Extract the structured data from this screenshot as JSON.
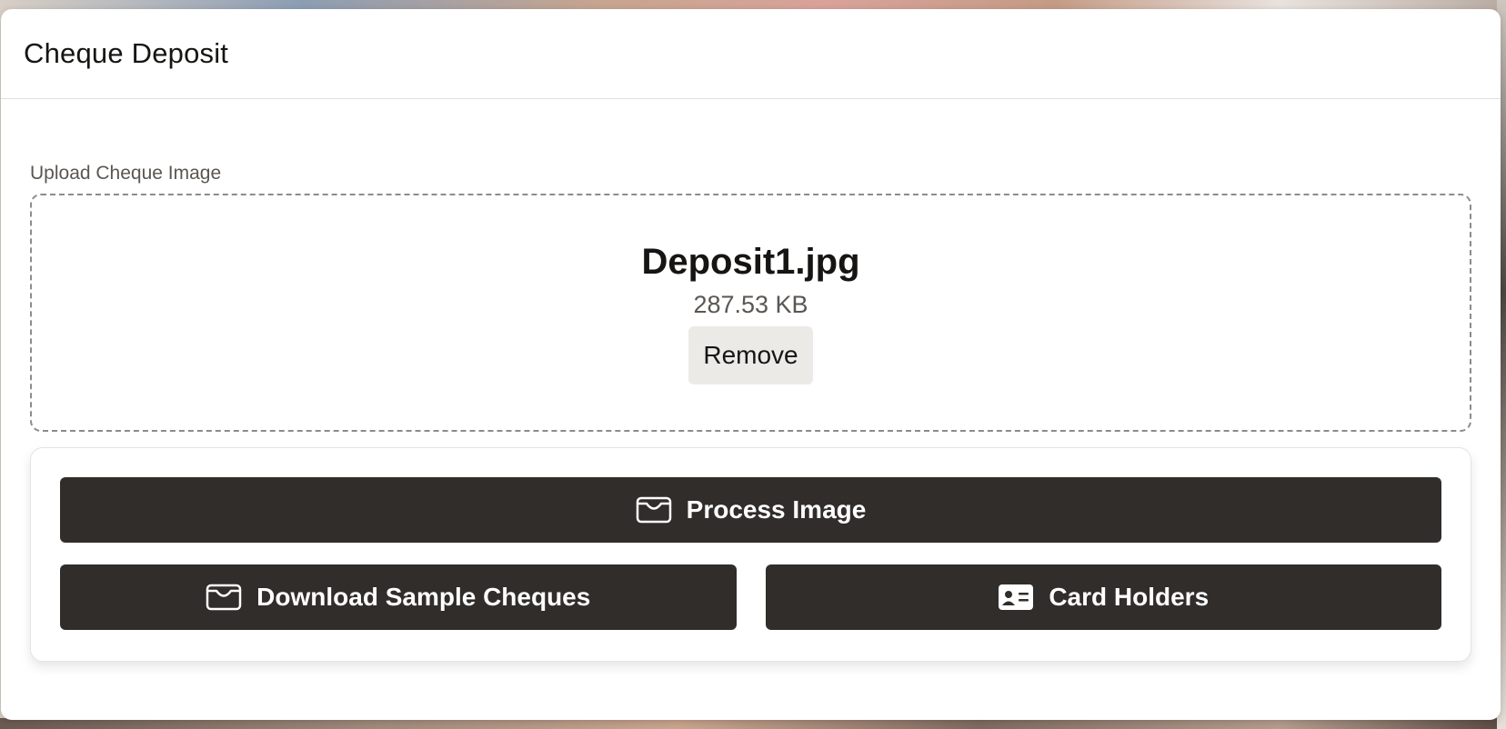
{
  "dialog": {
    "title": "Cheque Deposit"
  },
  "upload": {
    "label": "Upload Cheque Image",
    "file_name": "Deposit1.jpg",
    "file_size": "287.53 KB",
    "remove_label": "Remove"
  },
  "actions": {
    "process_label": "Process Image",
    "process_icon": "tray-icon",
    "download_label": "Download Sample Cheques",
    "download_icon": "tray-icon",
    "card_holders_label": "Card Holders",
    "card_holders_icon": "id-card-icon"
  },
  "colors": {
    "button_dark": "#312d2a",
    "text_primary": "#161513",
    "text_secondary": "#5b5652",
    "remove_bg": "#eceae7"
  }
}
